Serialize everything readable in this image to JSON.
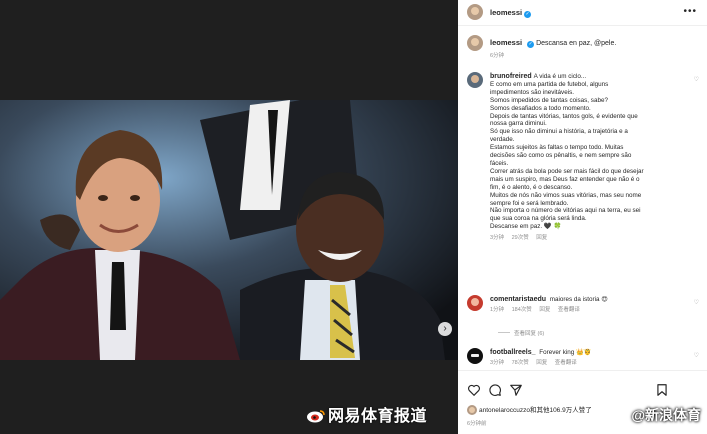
{
  "post": {
    "username": "leomessi",
    "caption_text": "Descansa en paz, @pele.",
    "caption_time": "6分钟",
    "post_time": "6分钟前"
  },
  "comments": [
    {
      "username": "brunofreired",
      "lines": [
        "A vida é um ciclo...",
        "E como em uma partida de futebol, alguns",
        "impedimentos são inevitáveis.",
        "Somos impedidos de tantas coisas, sabe?",
        "Somos desafiados a todo momento.",
        "Depois de tantas vitórias, tantos gols, é evidente que",
        "nossa garra diminui.",
        "Só que isso não diminui a história, a trajetória e a",
        "verdade.",
        "Estamos sujeitos às faltas o tempo todo. Muitas",
        "decisões são como os pênaltis, e nem sempre são",
        "fáceis.",
        "Correr atrás da bola pode ser mais fácil do que desejar",
        "mais um suspiro, mas Deus faz entender que não é o",
        "fim, é o alento, é o descanso.",
        "Muitos de nós não vimos suas vitórias, mas seu nome",
        "sempre foi e será lembrado.",
        "Não importa o número de vitórias aqui na terra, eu sei",
        "que sua coroa na glória será linda.",
        "Descanse em paz. 🖤 🍀"
      ],
      "time": "3分钟",
      "likes": "29次赞",
      "reply": "回复"
    },
    {
      "username": "comentaristaedu",
      "text": "maiores da istoria 😍",
      "time": "1分钟",
      "likes": "184次赞",
      "reply": "回复",
      "translate": "查看翻译",
      "view_replies": "查看回复 (6)"
    },
    {
      "username": "footballreels_",
      "text": "Forever king 👑🤴",
      "time": "3分钟",
      "likes": "78次赞",
      "reply": "回复",
      "translate": "查看翻译"
    }
  ],
  "likes_line": "antonelaroccuzzo和其他106.9万人赞了",
  "watermarks": {
    "left": "网易体育报道",
    "right": "@新浪体育"
  },
  "colors": {
    "verified": "#1d9bf0",
    "panel_bg": "#ffffff",
    "muted_text": "#8e8e8e"
  },
  "icons": [
    "more-icon",
    "heart-icon",
    "comment-icon",
    "share-icon",
    "bookmark-icon",
    "next-arrow-icon",
    "verified-icon",
    "weibo-logo-icon"
  ]
}
